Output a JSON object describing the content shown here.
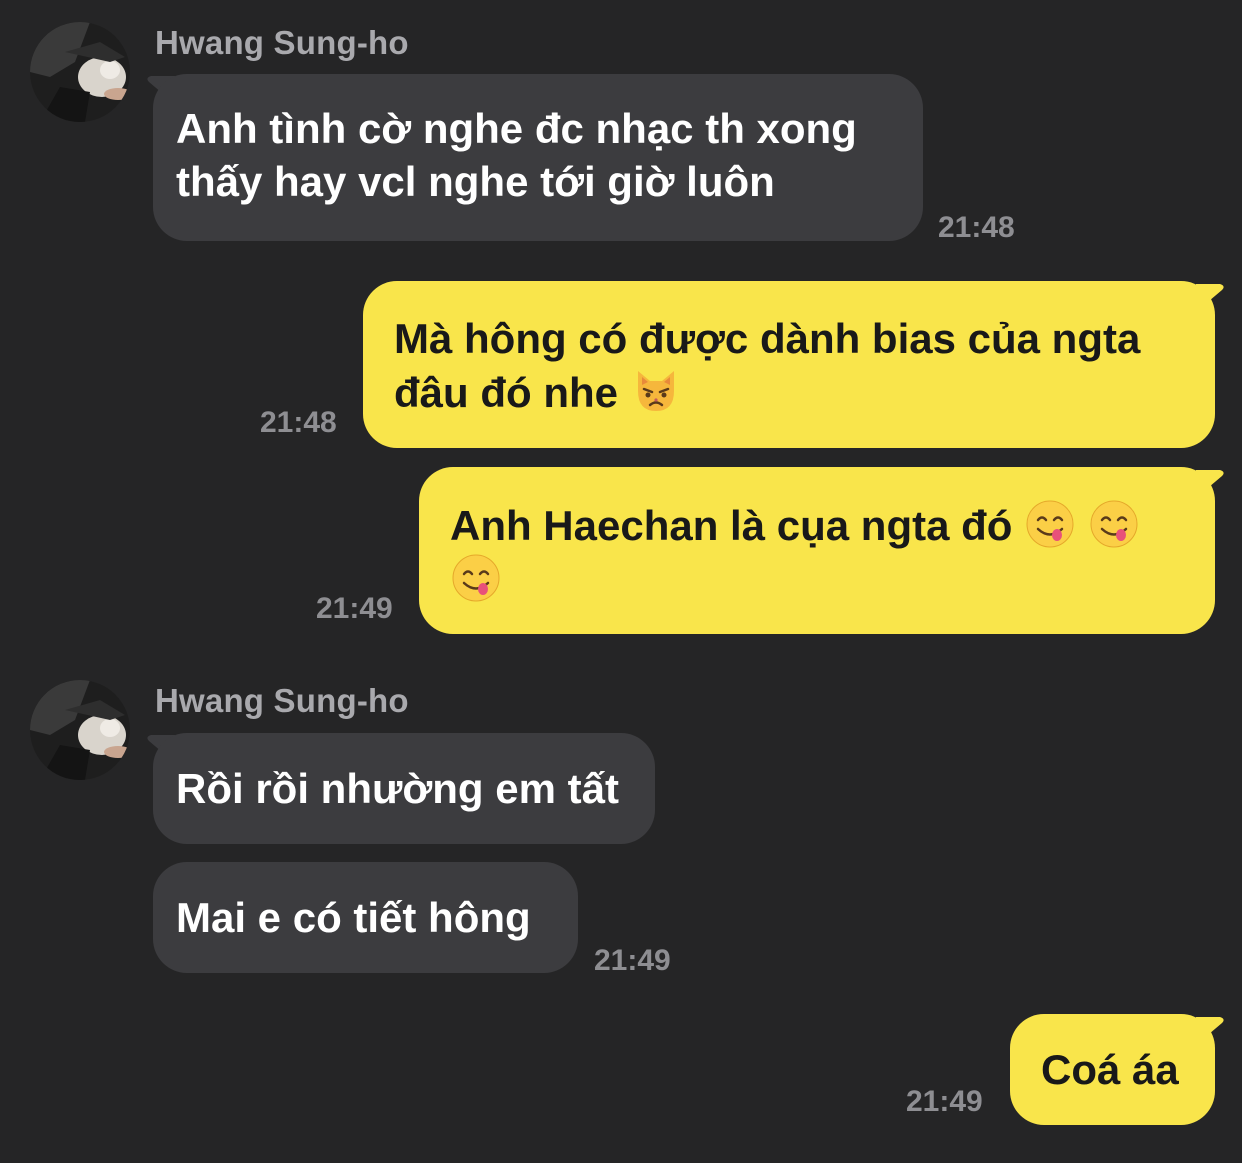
{
  "colors": {
    "background": "#252526",
    "incoming_bubble": "#3c3c3f",
    "outgoing_bubble": "#f9e54b",
    "sender_name": "#a9a9ad",
    "timestamp": "#8e8e92"
  },
  "messages": [
    {
      "sender": "Hwang Sung-ho",
      "direction": "incoming",
      "lines": [
        "Anh tình cờ nghe đc nhạc th xong",
        "thấy hay vcl nghe tới giờ luôn"
      ],
      "time": "21:48"
    },
    {
      "direction": "outgoing",
      "lines": [
        "Mà hông có được dành bias của ngta",
        "đâu đó nhe"
      ],
      "emoji": [
        "pouting-cat-emoji"
      ],
      "time": "21:48"
    },
    {
      "direction": "outgoing",
      "lines": [
        "Anh Haechan là cụa ngta đó"
      ],
      "emoji": [
        "savoring-face-emoji",
        "savoring-face-emoji",
        "savoring-face-emoji"
      ],
      "time": "21:49"
    },
    {
      "sender": "Hwang Sung-ho",
      "direction": "incoming",
      "lines": [
        "Rồi rồi nhường em tất"
      ]
    },
    {
      "direction": "incoming",
      "lines": [
        "Mai e có tiết hông"
      ],
      "time": "21:49"
    },
    {
      "direction": "outgoing",
      "lines": [
        "Coá áa"
      ],
      "time": "21:49"
    }
  ]
}
